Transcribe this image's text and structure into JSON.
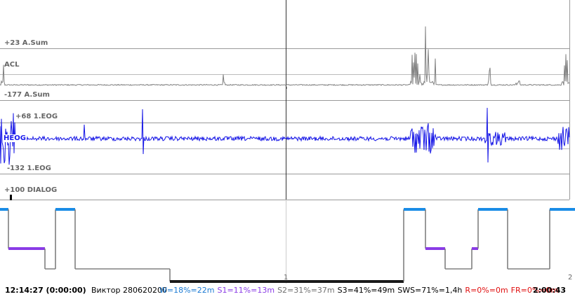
{
  "channels": {
    "acl": {
      "top_label": "+23 A.Sum",
      "name": "ACL",
      "bottom_label": "-177 A.Sum",
      "color": "#808080"
    },
    "heog": {
      "top_label": "+68 1.EOG",
      "name": "HEOG",
      "bottom_label": "-132 1.EOG",
      "color": "#1414e6"
    },
    "dialog": {
      "top_label": "+100 DIALOG"
    }
  },
  "hypnogram": {
    "page_marker": "1",
    "page_marker_right": "2",
    "stage_colors": {
      "W": "#1a8ce6",
      "S1": "#8a3ce6",
      "S2": "#808080",
      "S3": "#808080",
      "S4": "#1a1a1a"
    }
  },
  "status": {
    "start_time": "12:14:27 (0:00:00)",
    "end_time": "2:00:43",
    "patient": "Виктор 280620200",
    "stats": [
      {
        "text": "W=18%=22m",
        "color": "#1a7ad4"
      },
      {
        "text": "S1=11%=13m",
        "color": "#8a3ce6"
      },
      {
        "text": "S2=31%=37m",
        "color": "#707070"
      },
      {
        "text": "S3=41%=49m",
        "color": "#000000"
      },
      {
        "text": "SWS=71%=1,4h",
        "color": "#000000"
      },
      {
        "text": "R=0%=0m",
        "color": "#e01010"
      },
      {
        "text": "FR=0%=0m",
        "color": "#e01010"
      }
    ]
  }
}
